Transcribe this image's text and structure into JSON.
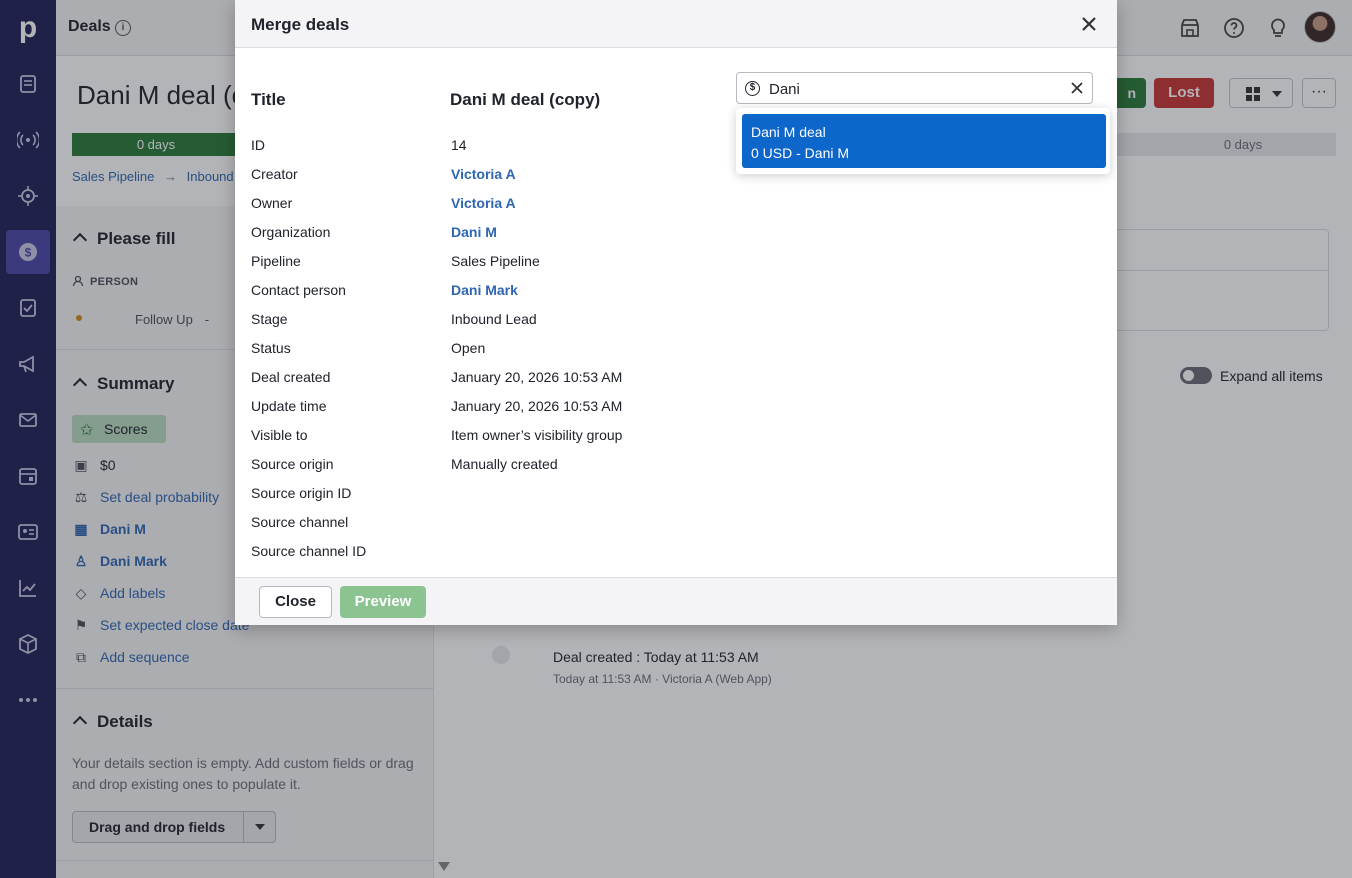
{
  "app": {
    "logo_text": "p",
    "header_title": "Deals",
    "nav_icons": [
      "leads-icon",
      "broadcast-icon",
      "target-icon",
      "deals-icon",
      "tasks-icon",
      "campaigns-icon",
      "mail-icon",
      "calendar-icon",
      "contacts-icon",
      "insights-icon",
      "products-icon",
      "more-icon"
    ],
    "top_icons": [
      "marketplace-icon",
      "help-icon",
      "lightbulb-icon",
      "avatar"
    ]
  },
  "background": {
    "deal_title": "Dani M deal (c",
    "stage_first": "0 days",
    "stage_last": "0 days",
    "breadcrumb_pipeline": "Sales Pipeline",
    "breadcrumb_arrow": "→",
    "breadcrumb_stage": "Inbound L",
    "won_label": "n",
    "lost_label": "Lost",
    "more_label": "···",
    "please_fill": "Please fill",
    "person_label": "PERSON",
    "follow_up": "Follow Up",
    "follow_up_dash": "-",
    "summary": "Summary",
    "scores": "Scores",
    "value": "$0",
    "set_probability": "Set deal probability",
    "org_link": "Dani M",
    "person_link": "Dani Mark",
    "add_labels": "Add labels",
    "set_close_date": "Set expected close date",
    "add_sequence": "Add sequence",
    "details": "Details",
    "details_text": "Your details section is empty. Add custom fields or drag and drop existing ones to populate it.",
    "dnd_button": "Drag and drop fields",
    "expand_all": "Expand all items",
    "timeline_title": "Deal created : Today at 11:53 AM",
    "timeline_sub": "Today at 11:53 AM · Victoria A (Web App)"
  },
  "modal": {
    "title": "Merge deals",
    "col_title": "Title",
    "col_deal": "Dani M deal (copy)",
    "rows": [
      {
        "label": "ID",
        "value": "14",
        "link": false
      },
      {
        "label": "Creator",
        "value": "Victoria A",
        "link": true
      },
      {
        "label": "Owner",
        "value": "Victoria A",
        "link": true
      },
      {
        "label": "Organization",
        "value": "Dani M",
        "link": true
      },
      {
        "label": "Pipeline",
        "value": "Sales Pipeline",
        "link": false
      },
      {
        "label": "Contact person",
        "value": "Dani Mark",
        "link": true
      },
      {
        "label": "Stage",
        "value": "Inbound Lead",
        "link": false
      },
      {
        "label": "Status",
        "value": "Open",
        "link": false
      },
      {
        "label": "Deal created",
        "value": "January 20, 2026 10:53 AM",
        "link": false
      },
      {
        "label": "Update time",
        "value": "January 20, 2026 10:53 AM",
        "link": false
      },
      {
        "label": "Visible to",
        "value": "Item owner’s visibility group",
        "link": false
      },
      {
        "label": "Source origin",
        "value": "Manually created",
        "link": false
      },
      {
        "label": "Source origin ID",
        "value": "",
        "link": false
      },
      {
        "label": "Source channel",
        "value": "",
        "link": false
      },
      {
        "label": "Source channel ID",
        "value": "",
        "link": false
      }
    ],
    "search_value": "Dani",
    "option_line1": "Dani M deal",
    "option_line2": "0 USD - Dani M",
    "close_button": "Close",
    "preview_button": "Preview"
  },
  "colors": {
    "rail": "#212058",
    "won_green": "#2a7a38",
    "lost_red": "#c73434",
    "link_blue": "#2e66b1",
    "option_selected": "#0d66c9",
    "preview_disabled": "#8cc491"
  }
}
